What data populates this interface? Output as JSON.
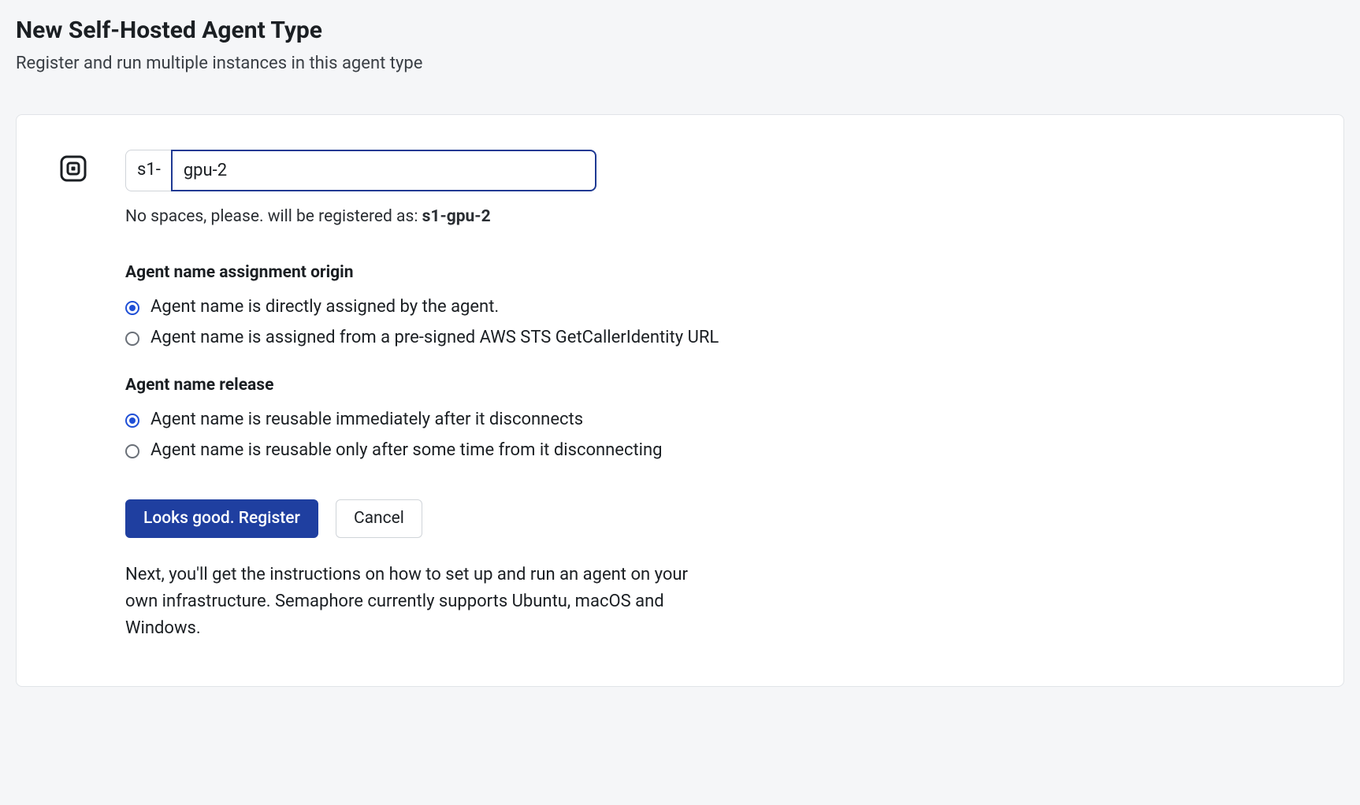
{
  "header": {
    "title": "New Self-Hosted Agent Type",
    "subtitle": "Register and run multiple instances in this agent type"
  },
  "form": {
    "prefix": "s1-",
    "name_value": "gpu-2",
    "hint_prefix": "No spaces, please. will be registered as: ",
    "hint_name": "s1-gpu-2",
    "section_origin_label": "Agent name assignment origin",
    "origin_options": [
      "Agent name is directly assigned by the agent.",
      "Agent name is assigned from a pre-signed AWS STS GetCallerIdentity URL"
    ],
    "section_release_label": "Agent name release",
    "release_options": [
      "Agent name is reusable immediately after it disconnects",
      "Agent name is reusable only after some time from it disconnecting"
    ],
    "register_label": "Looks good. Register",
    "cancel_label": "Cancel",
    "footnote": "Next, you'll get the instructions on how to set up and run an agent on your own infrastructure. Semaphore currently supports Ubuntu, macOS and Windows."
  }
}
